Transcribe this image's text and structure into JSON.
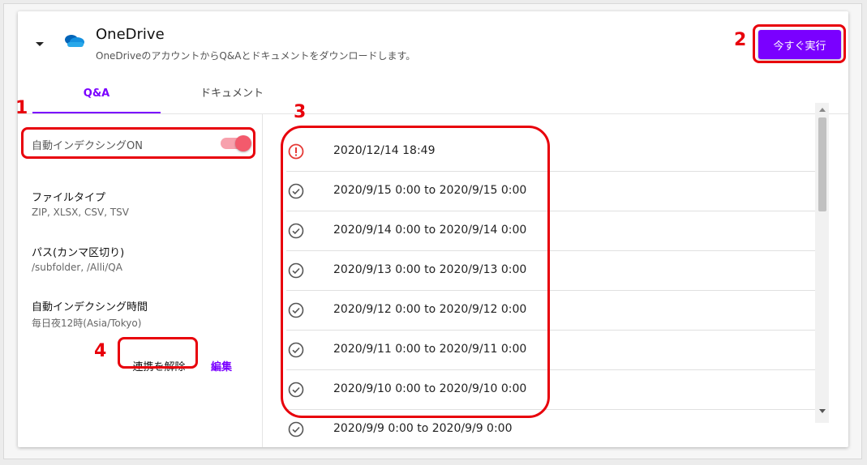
{
  "header": {
    "title": "OneDrive",
    "subtitle": "OneDriveのアカウントからQ&Aとドキュメントをダウンロードします。",
    "run_button": "今すぐ実行"
  },
  "tabs": [
    {
      "label": "Q&A",
      "active": true
    },
    {
      "label": "ドキュメント",
      "active": false
    }
  ],
  "settings": {
    "auto_index_label": "自動インデクシングON",
    "auto_index_on": true,
    "file_type_label": "ファイルタイプ",
    "file_type_value": "ZIP, XLSX, CSV, TSV",
    "path_label": "パス(カンマ区切り)",
    "path_value": "/subfolder, /Alli/QA",
    "schedule_label": "自動インデクシング時間",
    "schedule_value": "毎日夜12時(Asia/Tokyo)",
    "unlink_button": "連携を解除",
    "edit_link": "編集"
  },
  "runs": [
    {
      "status": "error",
      "range": "2020/12/14 18:49"
    },
    {
      "status": "success",
      "range": "2020/9/15 0:00 to 2020/9/15 0:00"
    },
    {
      "status": "success",
      "range": "2020/9/14 0:00 to 2020/9/14 0:00"
    },
    {
      "status": "success",
      "range": "2020/9/13 0:00 to 2020/9/13 0:00"
    },
    {
      "status": "success",
      "range": "2020/9/12 0:00 to 2020/9/12 0:00"
    },
    {
      "status": "success",
      "range": "2020/9/11 0:00 to 2020/9/11 0:00"
    },
    {
      "status": "success",
      "range": "2020/9/10 0:00 to 2020/9/10 0:00"
    },
    {
      "status": "success",
      "range": "2020/9/9 0:00 to 2020/9/9 0:00"
    }
  ],
  "annotations": [
    "1",
    "2",
    "3",
    "4"
  ],
  "colors": {
    "accent": "#7a00ff",
    "highlight": "#e8000b",
    "toggle": "#f35a6c",
    "error": "#e53935"
  }
}
